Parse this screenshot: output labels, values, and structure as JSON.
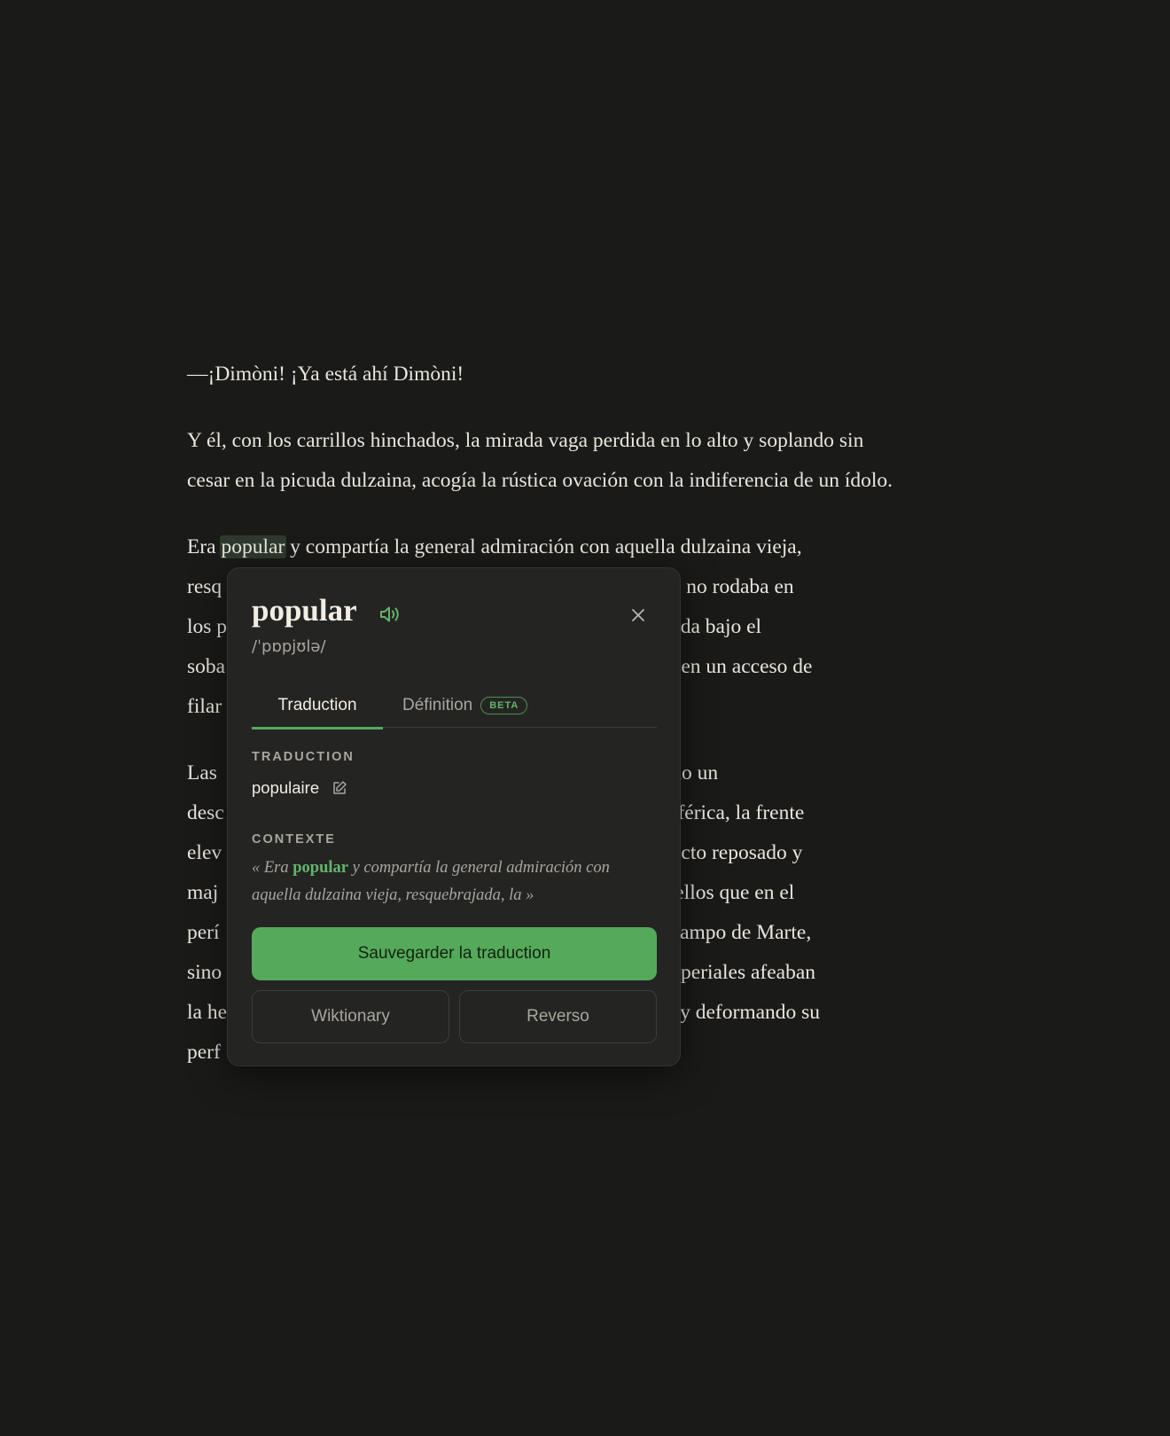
{
  "reader": {
    "paragraphs": [
      {
        "lines": [
          "—¡Dimòni! ¡Ya está ahí Dimòni!"
        ]
      },
      {
        "lines": [
          "Y él, con los carrillos hinchados, la mirada vaga perdida en lo alto y soplando sin",
          "cesar en la picuda dulzaina, acogía la rústica ovación con la indiferencia de un ídolo."
        ]
      },
      {
        "lines": [
          {
            "before": "Era ",
            "highlight": "popular",
            "after": " y compartía la general admiración con aquella dulzaina vieja,"
          },
          "resq                                                               , la que, cuando no rodaba en",
          "los p                                                              a siempre cruzada bajo el",
          "soba                                                               r la Naturaleza en un acceso de",
          "filar"
        ]
      },
      {
        "lines": [
          "Las                                                                do, habían hecho un",
          "desc                                                               on la cabeza esférica, la frente",
          "elev                                                               tenía en su aspecto reposado y",
          "maj                                                                pero no de aquellos que en el",
          "perí                                                               ustecían en el Campo de Marte,",
          "sino                                                               en las orgías imperiales afeaban",
          "la he                                                              nellón del vino y deformando su",
          "perf"
        ]
      }
    ]
  },
  "popup": {
    "word": "popular",
    "ipa": "/ˈpɒpjʊlə/",
    "tabs": {
      "traduction": "Traduction",
      "definition": "Définition",
      "beta_badge": "BETA"
    },
    "translation_label": "TRADUCTION",
    "translation_value": "populaire",
    "context_label": "CONTEXTE",
    "context": {
      "before": "« Era ",
      "word": "popular",
      "after": " y compartía la general admiración con aquella dulzaina vieja, resquebrajada, la »"
    },
    "save_button": "Sauvegarder la traduction",
    "wiktionary_button": "Wiktionary",
    "reverso_button": "Reverso"
  },
  "colors": {
    "background": "#1a1a19",
    "popup_bg": "#242423",
    "accent_green": "#55a95b",
    "text_primary": "#e9e6dd",
    "text_muted": "#a9a69e",
    "highlight_bg": "#2e3a2c"
  },
  "icons": {
    "speaker": "speaker-icon",
    "close": "close-icon",
    "edit": "edit-icon"
  }
}
